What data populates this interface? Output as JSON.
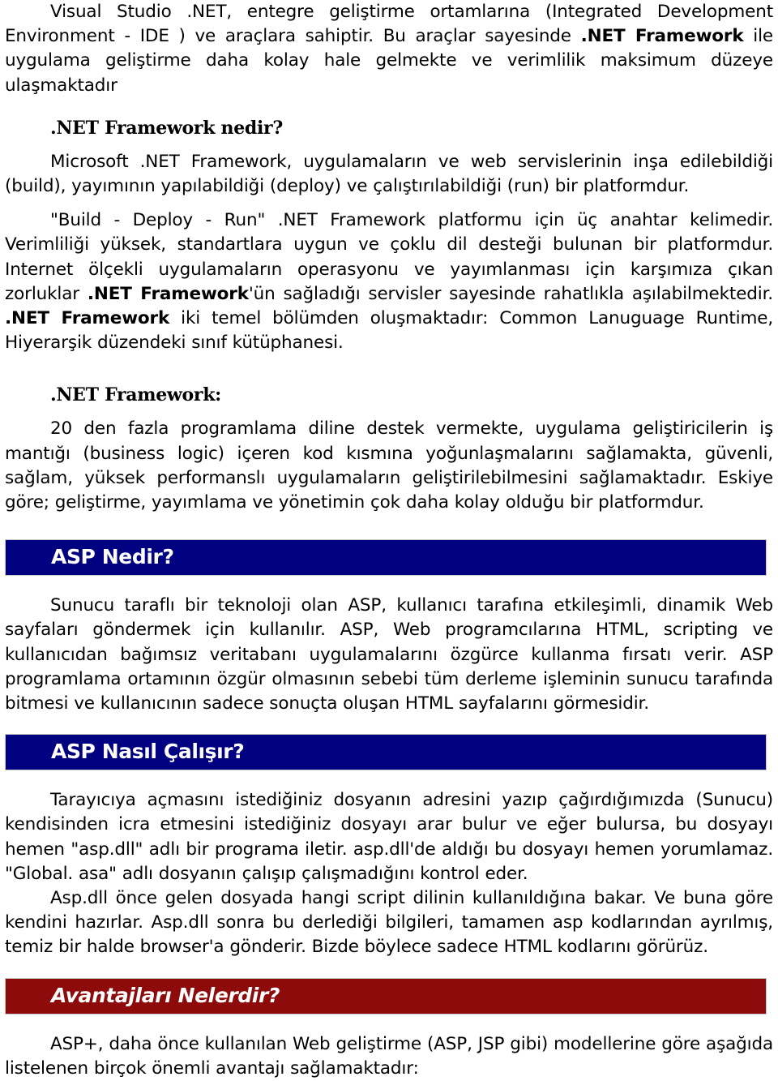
{
  "document": {
    "intro": {
      "text_before_bold": "Visual Studio .NET, entegre geliştirme ortamlarına (Integrated Development Environment - IDE ) ve araçlara sahiptir. Bu araçlar sayesinde ",
      "bold_term": ".NET Framework",
      "text_after_bold": " ile uygulama geliştirme daha kolay hale gelmekte ve verimlilik maksimum düzeye ulaşmaktadır"
    },
    "section_framework_nedir": {
      "heading": ".NET Framework nedir?",
      "paragraph_1": "Microsoft .NET Framework, uygulamaların ve web servislerinin inşa edilebildiği (build), yayımının yapılabildiği (deploy) ve çalıştırılabildiği (run) bir platformdur.",
      "paragraph_2_part_1": "\"Build - Deploy - Run\" .NET Framework platformu için üç anahtar kelimedir. Verimliliği yüksek, standartlara uygun ve çoklu dil desteği bulunan bir platformdur. Internet ölçekli uygulamaların operasyonu ve yayımlanması için karşımıza çıkan zorluklar ",
      "paragraph_2_bold_1": ".NET Framework",
      "paragraph_2_part_2": "'ün sağladığı servisler sayesinde rahatlıkla aşılabilmektedir. ",
      "paragraph_2_bold_2": ".NET Framework",
      "paragraph_2_part_3": " iki temel bölümden oluşmaktadır: Common Lanuguage Runtime, Hiyerarşik düzendeki sınıf kütüphanesi."
    },
    "section_framework_detay": {
      "heading": ".NET Framework:",
      "paragraph": "20 den fazla programlama diline destek vermekte, uygulama geliştiricilerin iş mantığı (business logic) içeren kod kısmına yoğunlaşmalarını sağlamakta, güvenli, sağlam, yüksek performanslı uygulamaların geliştirilebilmesini sağlamaktadır. Eskiye göre; geliştirme, yayımlama ve yönetimin çok daha kolay olduğu bir platformdur."
    },
    "section_asp_nedir": {
      "banner_title": "ASP Nedir?",
      "banner_color": "#000080",
      "paragraph": "Sunucu taraflı bir teknoloji olan ASP, kullanıcı tarafına etkileşimli, dinamik Web sayfaları göndermek için kullanılır. ASP, Web programcılarına HTML, scripting ve kullanıcıdan bağımsız veritabanı uygulamalarını özgürce kullanma fırsatı verir. ASP programlama ortamının özgür olmasının sebebi tüm derleme işleminin sunucu tarafında bitmesi ve kullanıcının sadece sonuçta oluşan HTML sayfalarını görmesidir."
    },
    "section_asp_nasil_calisir": {
      "banner_title": "ASP Nasıl Çalışır?",
      "banner_color": "#000080",
      "paragraph_1": "Tarayıcıya açmasını istediğiniz dosyanın adresini yazıp çağırdığımızda (Sunucu) kendisinden icra etmesini istediğiniz dosyayı arar bulur ve eğer bulursa, bu dosyayı hemen \"asp.dll\" adlı bir programa iletir. asp.dll'de aldığı bu dosyayı hemen yorumlamaz. \"Global. asa\" adlı dosyanın çalışıp çalışmadığını kontrol eder.",
      "paragraph_2": "Asp.dll önce gelen dosyada hangi script dilinin kullanıldığına bakar. Ve buna göre kendini hazırlar. Asp.dll sonra bu derlediği bilgileri, tamamen asp kodlarından ayrılmış, temiz bir halde browser'a gönderir. Bizde böylece sadece HTML kodlarını görürüz."
    },
    "section_avantajlari": {
      "banner_title": "Avantajları Nelerdir?",
      "banner_color": "#8e0b0b",
      "paragraph": "ASP+, daha önce kullanılan Web geliştirme (ASP, JSP gibi) modellerine göre aşağıda listelenen birçok önemli avantajı sağlamaktadır:"
    }
  }
}
